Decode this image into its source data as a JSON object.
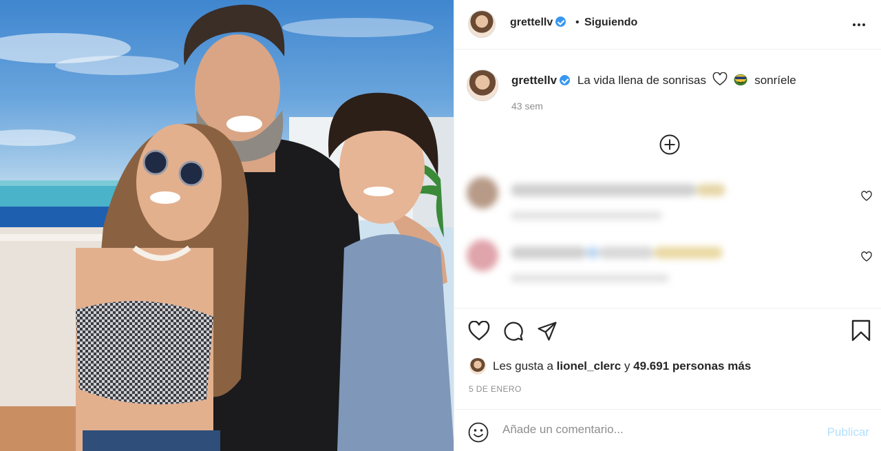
{
  "header": {
    "username": "grettellv",
    "separator": "•",
    "follow_status": "Siguiendo"
  },
  "post": {
    "caption_username": "grettellv",
    "caption_text": "La vida llena de sonrisas",
    "caption_suffix": "sonríele",
    "time_ago": "43 sem",
    "likes_prefix": "Les gusta a",
    "likes_user": "lionel_clerc",
    "likes_mid": "y",
    "likes_count": "49.691 personas más",
    "date": "5 DE ENERO"
  },
  "icons": {
    "more": "more-options-icon",
    "verified": "verified-badge-icon",
    "like": "heart-icon",
    "comment": "comment-icon",
    "share": "share-icon",
    "save": "bookmark-icon",
    "load_more": "plus-circle-icon",
    "emoji": "emoji-icon"
  },
  "comment_box": {
    "placeholder": "Añade un comentario...",
    "publish_label": "Publicar"
  },
  "colors": {
    "verified": "#3897f0",
    "publish_disabled": "#b2dffc",
    "muted": "#8e8e8e"
  }
}
